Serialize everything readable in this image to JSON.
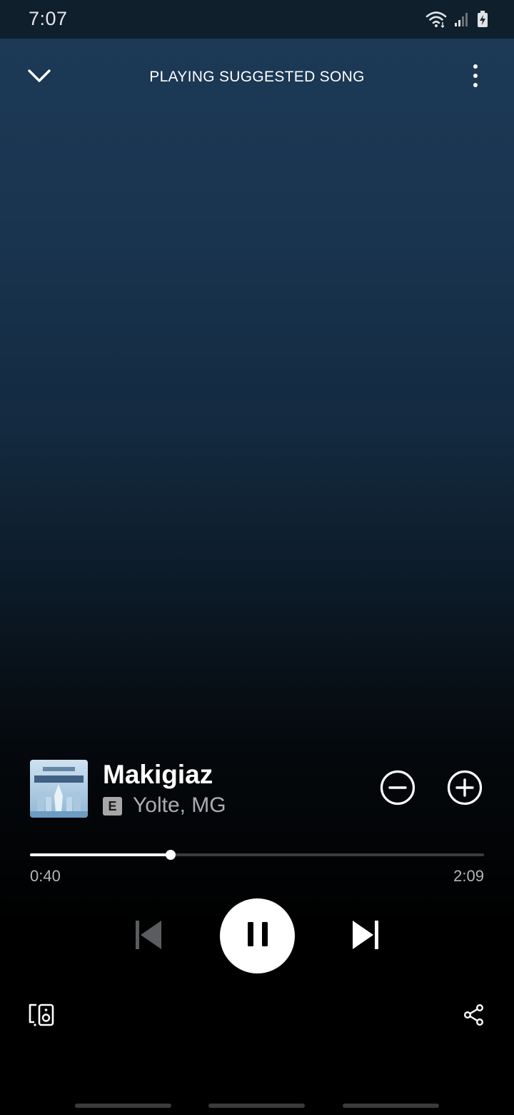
{
  "status_bar": {
    "time": "7:07",
    "battery_level": "7"
  },
  "header": {
    "context_title": "PLAYING SUGGESTED SONG",
    "collapse_icon": "chevron-down-icon",
    "more_icon": "more-vertical-icon"
  },
  "track": {
    "title": "Makigiaz",
    "artist": "Yolte, MG",
    "explicit_label": "E",
    "album_art_text": "YOLTE MG MAKIGIAZ"
  },
  "actions": {
    "remove_icon": "minus-circle-icon",
    "add_icon": "plus-circle-icon"
  },
  "playback": {
    "elapsed": "0:40",
    "total": "2:09",
    "progress_fraction": 0.31,
    "state": "playing",
    "prev_icon": "skip-previous-icon",
    "pause_icon": "pause-icon",
    "next_icon": "skip-next-icon"
  },
  "footer": {
    "devices_icon": "connect-devices-icon",
    "share_icon": "share-icon"
  },
  "colors": {
    "background_top": "#1c3a57",
    "background_bottom": "#000000",
    "accent": "#ffffff",
    "secondary_text": "#a9aeb2",
    "disabled_control": "#5a5d60"
  }
}
